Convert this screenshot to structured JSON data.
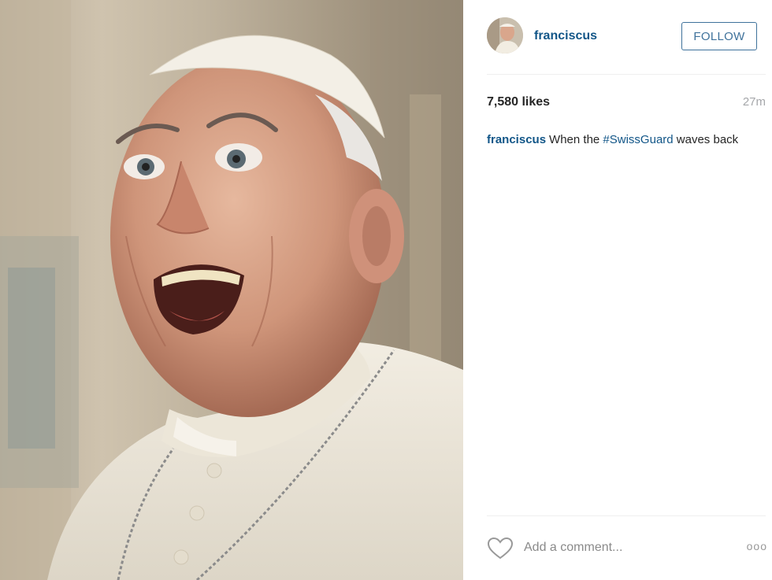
{
  "photo": {
    "alt": "Pope Francis smiling"
  },
  "header": {
    "username": "franciscus",
    "follow_label": "FOLLOW",
    "accent_color": "#3f729b",
    "username_color": "#125688"
  },
  "stats": {
    "likes": "7,580 likes",
    "time_ago": "27m"
  },
  "caption": {
    "username": "franciscus",
    "text_before": "When the ",
    "hashtag": "#SwissGuard",
    "text_after": " waves back"
  },
  "comment": {
    "placeholder": "Add a comment...",
    "like_icon": "heart-outline-icon",
    "more_icon": "ellipsis-icon",
    "more_label": "ooo"
  }
}
